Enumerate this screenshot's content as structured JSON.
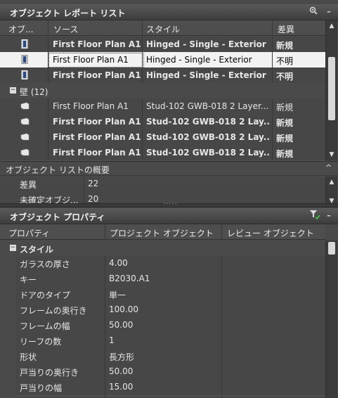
{
  "report": {
    "title": "オブジェクト レポート リスト",
    "columns": [
      "オブ...",
      "ソース",
      "スタイル",
      "差異"
    ],
    "door_rows": [
      {
        "source": "First Floor Plan A1",
        "style": "Hinged - Single - Exterior",
        "diff": "新規",
        "bold": true,
        "selected": false
      },
      {
        "source": "First Floor Plan A1",
        "style": "Hinged - Single - Exterior",
        "diff": "不明",
        "bold": false,
        "selected": true
      },
      {
        "source": "First Floor Plan A1",
        "style": "Hinged - Single - Exterior",
        "diff": "不明",
        "bold": true,
        "selected": false
      }
    ],
    "group": {
      "toggle": "−",
      "label": "壁 (12)"
    },
    "wall_rows": [
      {
        "source": "First Floor Plan A1",
        "style": "Stud-102 GWB-018 2 Layer...",
        "diff": "新規",
        "bold": false
      },
      {
        "source": "First Floor Plan A1",
        "style": "Stud-102 GWB-018 2 Lay...",
        "diff": "新規",
        "bold": true
      },
      {
        "source": "First Floor Plan A1",
        "style": "Stud-102 GWB-018 2 Lay...",
        "diff": "新規",
        "bold": true
      },
      {
        "source": "First Floor Plan A1",
        "style": "Stud-102 GWB-018 2 Lay...",
        "diff": "新規",
        "bold": true
      }
    ]
  },
  "summary": {
    "title": "オブジェクト リストの概要",
    "rows": [
      {
        "label": "差異",
        "value": "22"
      },
      {
        "label": "未確定オブジ...",
        "value": "20"
      }
    ]
  },
  "properties": {
    "title": "オブジェクト プロパティ",
    "columns": [
      "プロパティ",
      "プロジェクト オブジェクト",
      "レビュー オブジェクト"
    ],
    "category": {
      "toggle": "−",
      "label": "スタイル"
    },
    "rows": [
      {
        "name": "ガラスの厚さ",
        "project": "4.00",
        "review": ""
      },
      {
        "name": "キー",
        "project": "B2030.A1",
        "review": ""
      },
      {
        "name": "ドアのタイプ",
        "project": "単一",
        "review": ""
      },
      {
        "name": "フレームの奥行き",
        "project": "100.00",
        "review": ""
      },
      {
        "name": "フレームの幅",
        "project": "50.00",
        "review": ""
      },
      {
        "name": "リーフの数",
        "project": "1",
        "review": ""
      },
      {
        "name": "形状",
        "project": "長方形",
        "review": ""
      },
      {
        "name": "戸当りの奥行き",
        "project": "50.00",
        "review": ""
      },
      {
        "name": "戸当りの幅",
        "project": "15.00",
        "review": ""
      }
    ]
  },
  "icons": {
    "zoom": "magnifier-icon",
    "minimize": "minimize-icon",
    "filter": "filter-icon",
    "scroll_up": "▲",
    "scroll_down": "▼",
    "grip": "....."
  }
}
